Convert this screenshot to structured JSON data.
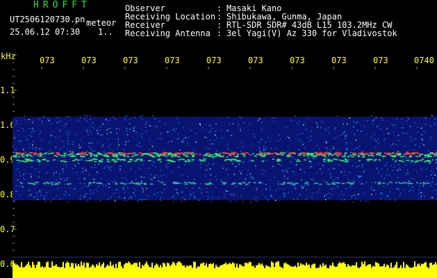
{
  "header": {
    "title": "HROFFT",
    "filename": "UT2506120730.pn",
    "label": "meteor",
    "datetime": "25.06.12 07:30",
    "page": "1..",
    "info": [
      {
        "key": "Observer",
        "value": "Masaki Kano"
      },
      {
        "key": "Receiving Location",
        "value": "Shibukawa, Gunma, Japan"
      },
      {
        "key": "Receiver",
        "value": "RTL-SDR SDR# 43dB L15 103.2MHz CW"
      },
      {
        "key": "Receiving Antenna",
        "value": "3el Yagi(V) Az 330 for Vladivostok"
      }
    ]
  },
  "axis": {
    "unit": "kHz",
    "y_ticks": [
      "1.1",
      "1.0",
      "0.9",
      "0.8",
      "0.7",
      "0.6"
    ],
    "time_ticks": [
      "073",
      "073",
      "073",
      "073",
      "073",
      "073",
      "073",
      "073",
      "073",
      "0740"
    ]
  },
  "colors": {
    "background": "#000000",
    "axis_text": "#ffff33",
    "header_label": "#ffffff",
    "title": "#33e04a",
    "noise_low": "#0a1a8c",
    "noise_mid": "#1f6fe0",
    "band_green": "#2ee86a",
    "band_red": "#ff3030",
    "amplitude_bar": "#ffff00"
  }
}
